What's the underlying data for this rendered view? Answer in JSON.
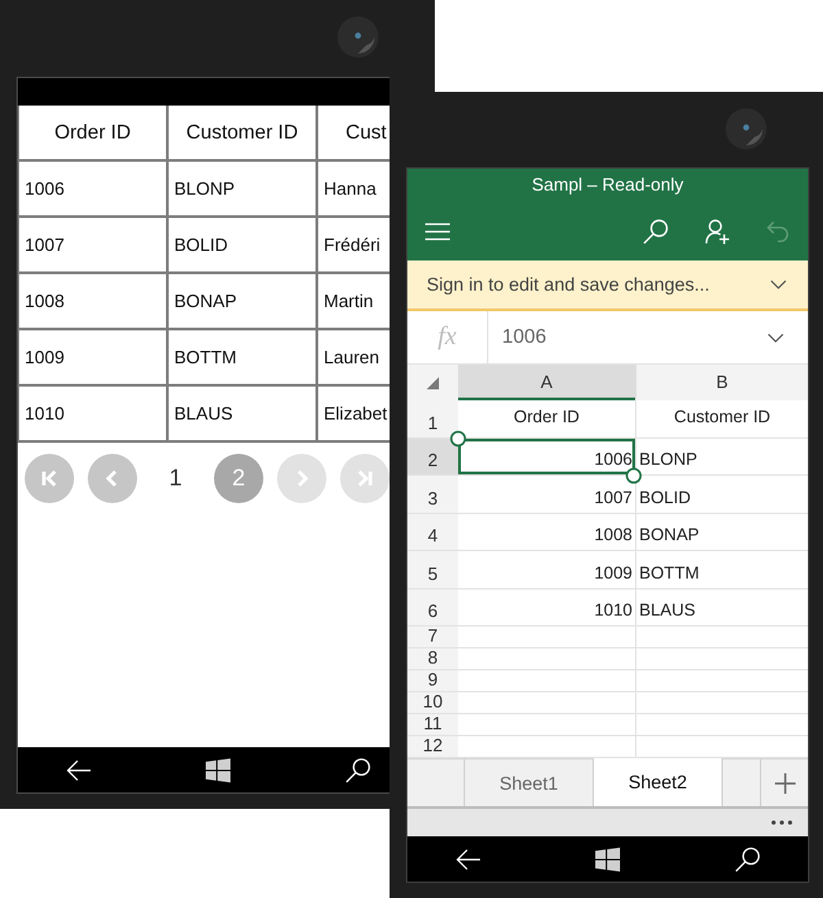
{
  "left_phone": {
    "grid": {
      "columns": [
        "Order ID",
        "Customer ID",
        "Cust"
      ],
      "rows": [
        [
          "1006",
          "BLONP",
          "Hanna"
        ],
        [
          "1007",
          "BOLID",
          "Frédéri"
        ],
        [
          "1008",
          "BONAP",
          "Martin"
        ],
        [
          "1009",
          "BOTTM",
          "Lauren"
        ],
        [
          "1010",
          "BLAUS",
          "Elizabet"
        ]
      ]
    },
    "pager": {
      "first": {
        "disabled": false
      },
      "previous": {
        "disabled": false
      },
      "pages": [
        {
          "label": "1",
          "selected": false
        },
        {
          "label": "2",
          "selected": true
        }
      ],
      "next": {
        "disabled": true
      },
      "last": {
        "disabled": true
      }
    }
  },
  "right_phone": {
    "title": "Sampl – Read-only",
    "toolbar": [
      {
        "kind": "menu",
        "disabled": false
      },
      {
        "kind": "search",
        "disabled": false
      },
      {
        "kind": "share",
        "disabled": false
      },
      {
        "kind": "undo",
        "disabled": true
      }
    ],
    "sign_in_banner": "Sign in to edit and save changes...",
    "formula_bar": {
      "label": "fx",
      "value": "1006"
    },
    "sheet": {
      "columns": [
        {
          "label": "A",
          "selected": true
        },
        {
          "label": "B",
          "selected": false
        }
      ],
      "rows": [
        {
          "label": "1",
          "selected": false,
          "cells": [
            {
              "kind": "heading",
              "text": "Order ID",
              "selected": false
            },
            {
              "kind": "heading",
              "text": "Customer ID",
              "selected": false
            }
          ]
        },
        {
          "label": "2",
          "selected": true,
          "cells": [
            {
              "kind": "number",
              "text": "1006",
              "selected": true
            },
            {
              "kind": "text",
              "text": "BLONP",
              "selected": false
            }
          ]
        },
        {
          "label": "3",
          "selected": false,
          "cells": [
            {
              "kind": "number",
              "text": "1007",
              "selected": false
            },
            {
              "kind": "text",
              "text": "BOLID",
              "selected": false
            }
          ]
        },
        {
          "label": "4",
          "selected": false,
          "cells": [
            {
              "kind": "number",
              "text": "1008",
              "selected": false
            },
            {
              "kind": "text",
              "text": "BONAP",
              "selected": false
            }
          ]
        },
        {
          "label": "5",
          "selected": false,
          "cells": [
            {
              "kind": "number",
              "text": "1009",
              "selected": false
            },
            {
              "kind": "text",
              "text": "BOTTM",
              "selected": false
            }
          ]
        },
        {
          "label": "6",
          "selected": false,
          "cells": [
            {
              "kind": "number",
              "text": "1010",
              "selected": false
            },
            {
              "kind": "text",
              "text": "BLAUS",
              "selected": false
            }
          ]
        },
        {
          "label": "7",
          "selected": false
        },
        {
          "label": "8",
          "selected": false
        },
        {
          "label": "9",
          "selected": false
        },
        {
          "label": "10",
          "selected": false
        },
        {
          "label": "11",
          "selected": false
        },
        {
          "label": "12",
          "selected": false
        }
      ]
    },
    "sheet_tabs": [
      {
        "label": "Sheet1",
        "selected": false
      },
      {
        "label": "Sheet2",
        "selected": true
      }
    ]
  }
}
